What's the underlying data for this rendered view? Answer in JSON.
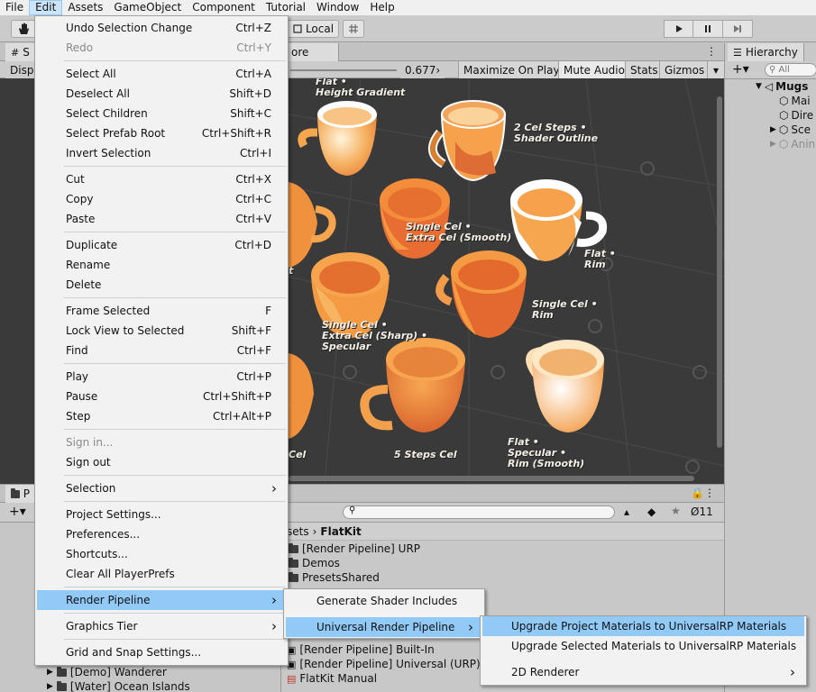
{
  "menubar": [
    "File",
    "Edit",
    "Assets",
    "GameObject",
    "Component",
    "Tutorial",
    "Window",
    "Help"
  ],
  "toolbar": {
    "local_label": "Local"
  },
  "game_panel": {
    "tab_partial_left": "S",
    "tab_partial_right": "ore",
    "display_partial": "Displ",
    "scale_value": "0.677›",
    "buttons": [
      "Maximize On Play",
      "Mute Audio",
      "Stats",
      "Gizmos"
    ],
    "mug_labels": [
      "Flat •\nHeight Gradient",
      "2 Cel Steps •\nShader Outline",
      "Single Cel •\nExtra Cel (Smooth)",
      "Flat •\nRim",
      "Single Cel •\nRim",
      "Single Cel •\nExtra Cel (Sharp) •\nSpecular",
      "5 Steps Cel",
      "Flat •\nSpecular •\nRim (Smooth)",
      "Cel",
      "t"
    ]
  },
  "hierarchy": {
    "title": "Hierarchy",
    "search_placeholder": "All",
    "root": "Mugs",
    "children": [
      "Mai",
      "Dire",
      "Sce",
      "Anin"
    ]
  },
  "project": {
    "tab_partial": "P",
    "counter": "11",
    "breadcrumb": [
      "sets",
      "FlatKit"
    ],
    "folders": [
      "[Render Pipeline] URP",
      "Demos",
      "PresetsShared"
    ],
    "assets_bottom": [
      "[Render Pipeline] Built-In",
      "[Render Pipeline] Universal (URP)",
      "FlatKit Manual"
    ],
    "left_folders": [
      "[Demo] Wanderer",
      "[Water] Ocean Islands"
    ]
  },
  "edit_menu": {
    "items": [
      {
        "label": "Undo Selection Change",
        "shortcut": "Ctrl+Z"
      },
      {
        "label": "Redo",
        "shortcut": "Ctrl+Y",
        "disabled": true
      },
      {
        "sep": true
      },
      {
        "label": "Select All",
        "shortcut": "Ctrl+A"
      },
      {
        "label": "Deselect All",
        "shortcut": "Shift+D"
      },
      {
        "label": "Select Children",
        "shortcut": "Shift+C"
      },
      {
        "label": "Select Prefab Root",
        "shortcut": "Ctrl+Shift+R"
      },
      {
        "label": "Invert Selection",
        "shortcut": "Ctrl+I"
      },
      {
        "sep": true
      },
      {
        "label": "Cut",
        "shortcut": "Ctrl+X"
      },
      {
        "label": "Copy",
        "shortcut": "Ctrl+C"
      },
      {
        "label": "Paste",
        "shortcut": "Ctrl+V"
      },
      {
        "sep": true
      },
      {
        "label": "Duplicate",
        "shortcut": "Ctrl+D"
      },
      {
        "label": "Rename",
        "shortcut": ""
      },
      {
        "label": "Delete",
        "shortcut": ""
      },
      {
        "sep": true
      },
      {
        "label": "Frame Selected",
        "shortcut": "F"
      },
      {
        "label": "Lock View to Selected",
        "shortcut": "Shift+F"
      },
      {
        "label": "Find",
        "shortcut": "Ctrl+F"
      },
      {
        "sep": true
      },
      {
        "label": "Play",
        "shortcut": "Ctrl+P"
      },
      {
        "label": "Pause",
        "shortcut": "Ctrl+Shift+P"
      },
      {
        "label": "Step",
        "shortcut": "Ctrl+Alt+P"
      },
      {
        "sep": true
      },
      {
        "label": "Sign in...",
        "shortcut": "",
        "disabled": true
      },
      {
        "label": "Sign out",
        "shortcut": ""
      },
      {
        "sep": true
      },
      {
        "label": "Selection",
        "shortcut": "",
        "submenu": true
      },
      {
        "sep": true
      },
      {
        "label": "Project Settings...",
        "shortcut": ""
      },
      {
        "label": "Preferences...",
        "shortcut": ""
      },
      {
        "label": "Shortcuts...",
        "shortcut": ""
      },
      {
        "label": "Clear All PlayerPrefs",
        "shortcut": ""
      },
      {
        "sep": true
      },
      {
        "label": "Render Pipeline",
        "shortcut": "",
        "submenu": true,
        "highlighted": true
      },
      {
        "sep": true
      },
      {
        "label": "Graphics Tier",
        "shortcut": "",
        "submenu": true
      },
      {
        "sep": true
      },
      {
        "label": "Grid and Snap Settings...",
        "shortcut": ""
      }
    ]
  },
  "render_pipeline_menu": {
    "items": [
      {
        "label": "Generate Shader Includes"
      },
      {
        "label": "Universal Render Pipeline",
        "submenu": true,
        "highlighted": true
      }
    ]
  },
  "urp_menu": {
    "items": [
      {
        "label": "Upgrade Project Materials to UniversalRP Materials",
        "highlighted": true
      },
      {
        "label": "Upgrade Selected Materials to UniversalRP Materials"
      },
      {
        "label": "2D Renderer",
        "submenu": true
      }
    ]
  },
  "colors": {
    "menu_highlight": "#91c9f7",
    "viewport_bg": "#3a3a3a",
    "mug_orange": "#f39a3a"
  }
}
